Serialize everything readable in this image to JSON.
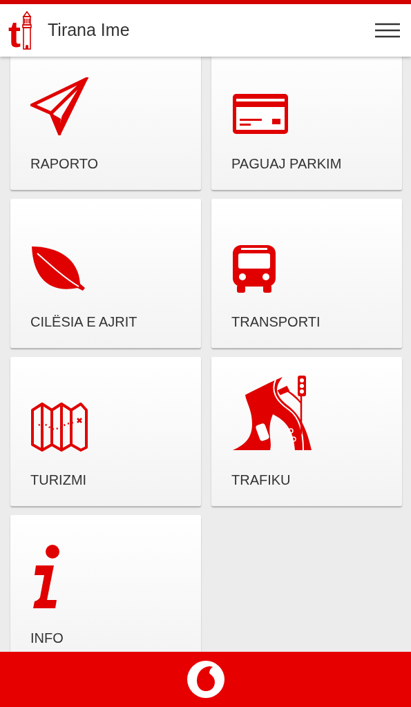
{
  "header": {
    "logo_letter": "t",
    "title": "Tirana Ime"
  },
  "tiles": [
    {
      "kind": "report",
      "label": "RAPORTO"
    },
    {
      "kind": "parking",
      "label": "PAGUAJ PARKIM"
    },
    {
      "kind": "air",
      "label": "CILËSIA E AJRIT"
    },
    {
      "kind": "transport",
      "label": "TRANSPORTI"
    },
    {
      "kind": "tourism",
      "label": "TURIZMI"
    },
    {
      "kind": "traffic",
      "label": "TRAFIKU"
    },
    {
      "kind": "info",
      "label": "INFO"
    }
  ]
}
